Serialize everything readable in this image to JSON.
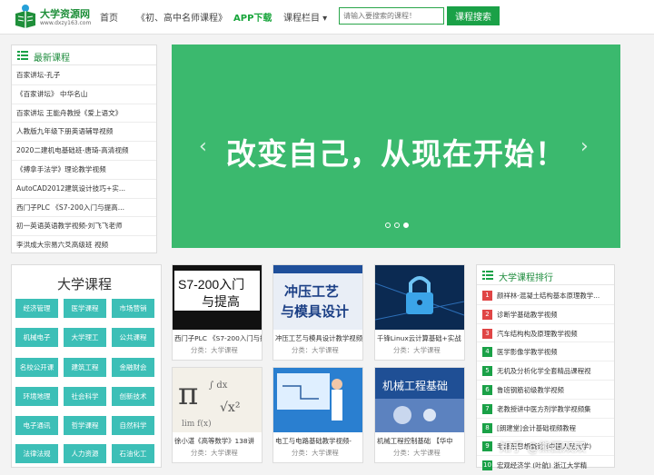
{
  "header": {
    "logo_title": "大学资源网",
    "logo_url": "www.dxzy163.com",
    "nav": [
      "首页",
      "《初、高中名师课程》",
      "APP下载",
      "课程栏目 ▾"
    ],
    "search_placeholder": "请输入要搜索的课程！",
    "search_button": "课程搜索"
  },
  "latest": {
    "title": "最新课程",
    "items": [
      "百家讲坛-孔子",
      "《百家讲坛》 中华名山",
      "百家讲坛 王能舟教授《爱上语文》",
      "人教版九年级下册英语辅导视频",
      "2020二建机电基础班-唐琦-高清视频",
      "《搏拿手法学》理论教学视频",
      "AutoCAD2012建筑设计技巧+实...",
      "西门子PLC 《S7-200入门与提高...",
      "初一英语英语教学视频-刘飞飞老师",
      "李洪成大宗易六爻高级班 视频"
    ]
  },
  "banner": {
    "text": "改变自己，从现在开始！",
    "prev": "‹",
    "next": "›"
  },
  "categories": {
    "title": "大学课程",
    "items": [
      "经济管理",
      "医学课程",
      "市场营销",
      "机械电子",
      "大学理工",
      "公共课程",
      "名校公开课",
      "建筑工程",
      "金融财会",
      "环境地理",
      "社会科学",
      "创新技术",
      "电子通讯",
      "哲学课程",
      "自然科学",
      "法律法规",
      "人力资源",
      "石油化工"
    ]
  },
  "courses": [
    {
      "thumb_text": "S7-200入门\n与提高",
      "title": "西门子PLC 《S7-200入门与提高》",
      "meta": "分类：大学课程"
    },
    {
      "thumb_text": "冲压工艺\n与模具设计",
      "title": "冲压工艺与模具设计教学视频",
      "meta": "分类：大学课程"
    },
    {
      "thumb_text": "",
      "title": "千锋Linux云计算基础+实战",
      "meta": "分类：大学课程"
    },
    {
      "thumb_text": "",
      "title": "徐小湛《高等数学》138讲",
      "meta": "分类：大学课程"
    },
    {
      "thumb_text": "",
      "title": "电工与电路基础教学视频-",
      "meta": "分类：大学课程"
    },
    {
      "thumb_text": "机械工程基础",
      "title": "机械工程控制基础 【华中",
      "meta": "分类：大学课程"
    }
  ],
  "ranking": {
    "title": "大学课程排行",
    "items": [
      {
        "num": "1",
        "text": "颜祥林-混凝土结构基本原理教学..."
      },
      {
        "num": "2",
        "text": "诊断学基础教学视频"
      },
      {
        "num": "3",
        "text": "汽车结构构及原理教学视频"
      },
      {
        "num": "4",
        "text": "医学影像学教学视频"
      },
      {
        "num": "5",
        "text": "无机及分析化学全套精品课程视"
      },
      {
        "num": "6",
        "text": "鲁班钢筋初级教学视频"
      },
      {
        "num": "7",
        "text": "老教授讲中医方剂学教学视频集"
      },
      {
        "num": "8",
        "text": "[朗建堂]会计基础视频教程"
      },
      {
        "num": "9",
        "text": "毛泽东思想概论 (中国人民大学)"
      },
      {
        "num": "10",
        "text": "宏观经济学 (叶航) 浙江大学精"
      }
    ]
  },
  "watermark": "知乎 @熊西双双",
  "colors": {
    "brand": "#1aa147",
    "banner": "#3bb96e",
    "category": "#3cbfb7",
    "rank_top": "#e04545",
    "rank_other": "#1aa147"
  }
}
